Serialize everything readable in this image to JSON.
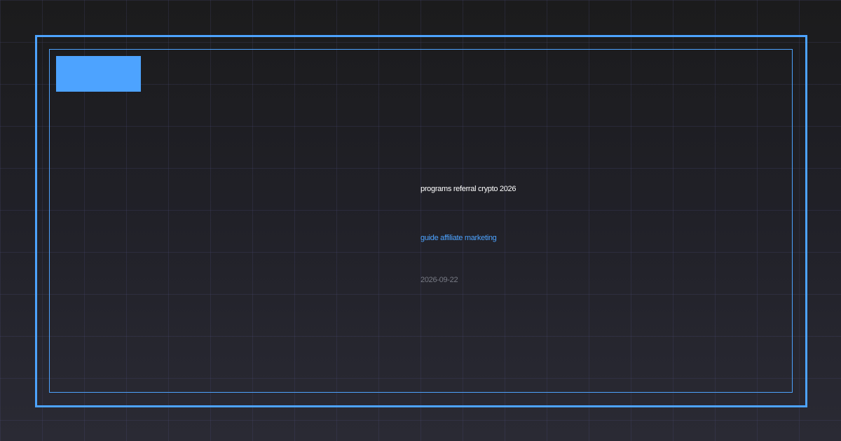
{
  "card": {
    "title": "programs referral crypto 2026",
    "subtitle": "guide affiliate marketing",
    "date": "2026-09-22"
  },
  "colors": {
    "accent": "#4da3ff",
    "title_text": "#ffffff",
    "date_text": "#777a84",
    "background_top": "#1b1b1c",
    "background_bottom": "#2a2a34"
  }
}
